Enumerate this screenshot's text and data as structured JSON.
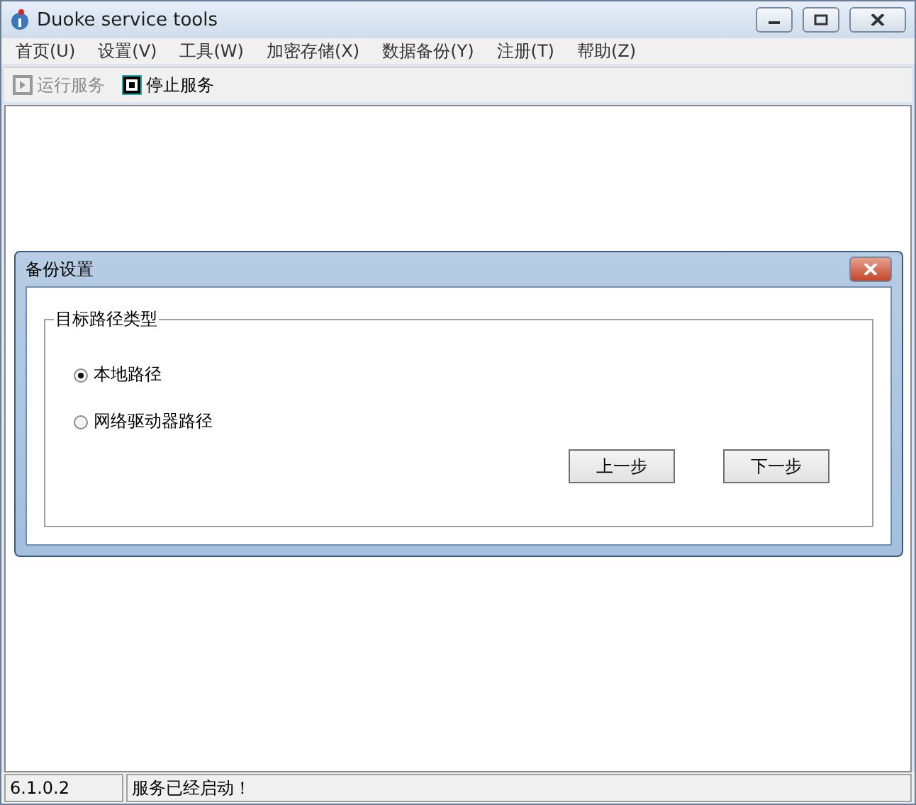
{
  "window": {
    "title": "Duoke service tools"
  },
  "menu": [
    "首页(U)",
    "设置(V)",
    "工具(W)",
    "加密存储(X)",
    "数据备份(Y)",
    "注册(T)",
    "帮助(Z)"
  ],
  "toolbar": [
    {
      "label": "运行服务",
      "kind": "run",
      "disabled": true
    },
    {
      "label": "停止服务",
      "kind": "stop",
      "disabled": false
    }
  ],
  "dialog": {
    "title": "备份设置",
    "group_title": "目标路径类型",
    "options": [
      {
        "label": "本地路径",
        "selected": true
      },
      {
        "label": "网络驱动器路径",
        "selected": false
      }
    ],
    "buttons": [
      "上一步",
      "下一步"
    ]
  },
  "status_bar": [
    "6.1.0.2",
    "服务已经启动！"
  ]
}
